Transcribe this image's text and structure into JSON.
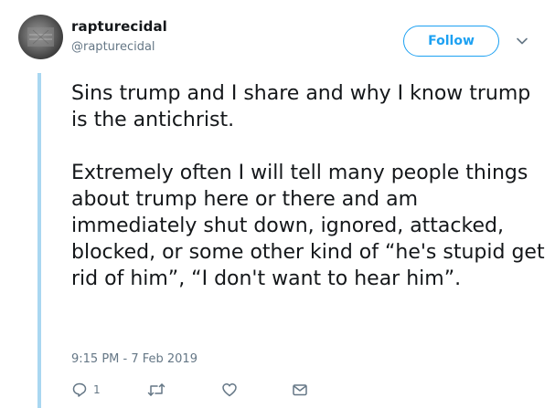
{
  "user": {
    "display_name": "rapturecidal",
    "handle": "@rapturecidal"
  },
  "follow_label": "Follow",
  "tweet": {
    "text": "Sins trump and I share and why I know trump is the antichrist.\n\nExtremely often I will tell many people things about trump here or there and am immediately shut down, ignored, attacked, blocked, or some other kind of “he's stupid get rid of him”, “I don't want to hear him”.",
    "timestamp": "9:15 PM - 7 Feb 2019",
    "reply_count": "1"
  },
  "icons": {
    "caret": "chevron-down-icon",
    "reply": "reply-icon",
    "retweet": "retweet-icon",
    "like": "heart-icon",
    "dm": "envelope-icon"
  },
  "colors": {
    "accent": "#1da1f2",
    "text_primary": "#14171a",
    "text_secondary": "#657786",
    "thread_line": "#a9d7f1"
  }
}
